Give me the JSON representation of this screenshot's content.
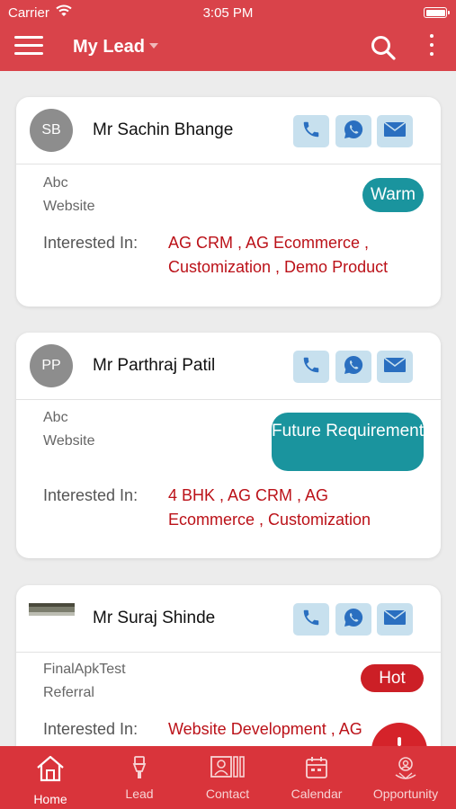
{
  "status_bar": {
    "carrier": "Carrier",
    "time": "3:05 PM"
  },
  "nav": {
    "title": "My Lead",
    "icons": [
      "menu-icon",
      "dropdown-caret-icon",
      "search-icon",
      "more-vertical-icon"
    ]
  },
  "leads": [
    {
      "initials": "SB",
      "name": "Mr Sachin Bhange",
      "company": "Abc",
      "source": "Website",
      "status": "Warm",
      "status_color": "#1a949e",
      "interested_label": "Interested In:",
      "interested": "AG CRM , AG Ecommerce , Customization , Demo Product"
    },
    {
      "initials": "PP",
      "name": "Mr Parthraj Patil",
      "company": "Abc",
      "source": "Website",
      "status": "Future Requirement",
      "status_color": "#1a949e",
      "interested_label": "Interested In:",
      "interested": "4 BHK , AG CRM , AG Ecommerce , Customization"
    },
    {
      "initials": "",
      "name": "Mr Suraj Shinde",
      "company": "FinalApkTest",
      "source": "Referral",
      "status": "Hot",
      "status_color": "#cc1f26",
      "interested_label": "Interested In:",
      "interested": "Website Development , AG"
    }
  ],
  "actions": {
    "icons": [
      "phone-icon",
      "whatsapp-icon",
      "mail-icon"
    ]
  },
  "tabs": [
    {
      "label": "Home",
      "icon": "home-icon"
    },
    {
      "label": "Lead",
      "icon": "torch-icon"
    },
    {
      "label": "Contact",
      "icon": "contact-card-icon"
    },
    {
      "label": "Calendar",
      "icon": "calendar-icon"
    },
    {
      "label": "Opportunity",
      "icon": "opportunity-icon"
    }
  ],
  "colors": {
    "brand": "#d9434a",
    "tab_bar": "#d9343b",
    "accent_red": "#bb1118",
    "action_bg": "#c7e0ee",
    "action_icon": "#2a6fc0"
  }
}
